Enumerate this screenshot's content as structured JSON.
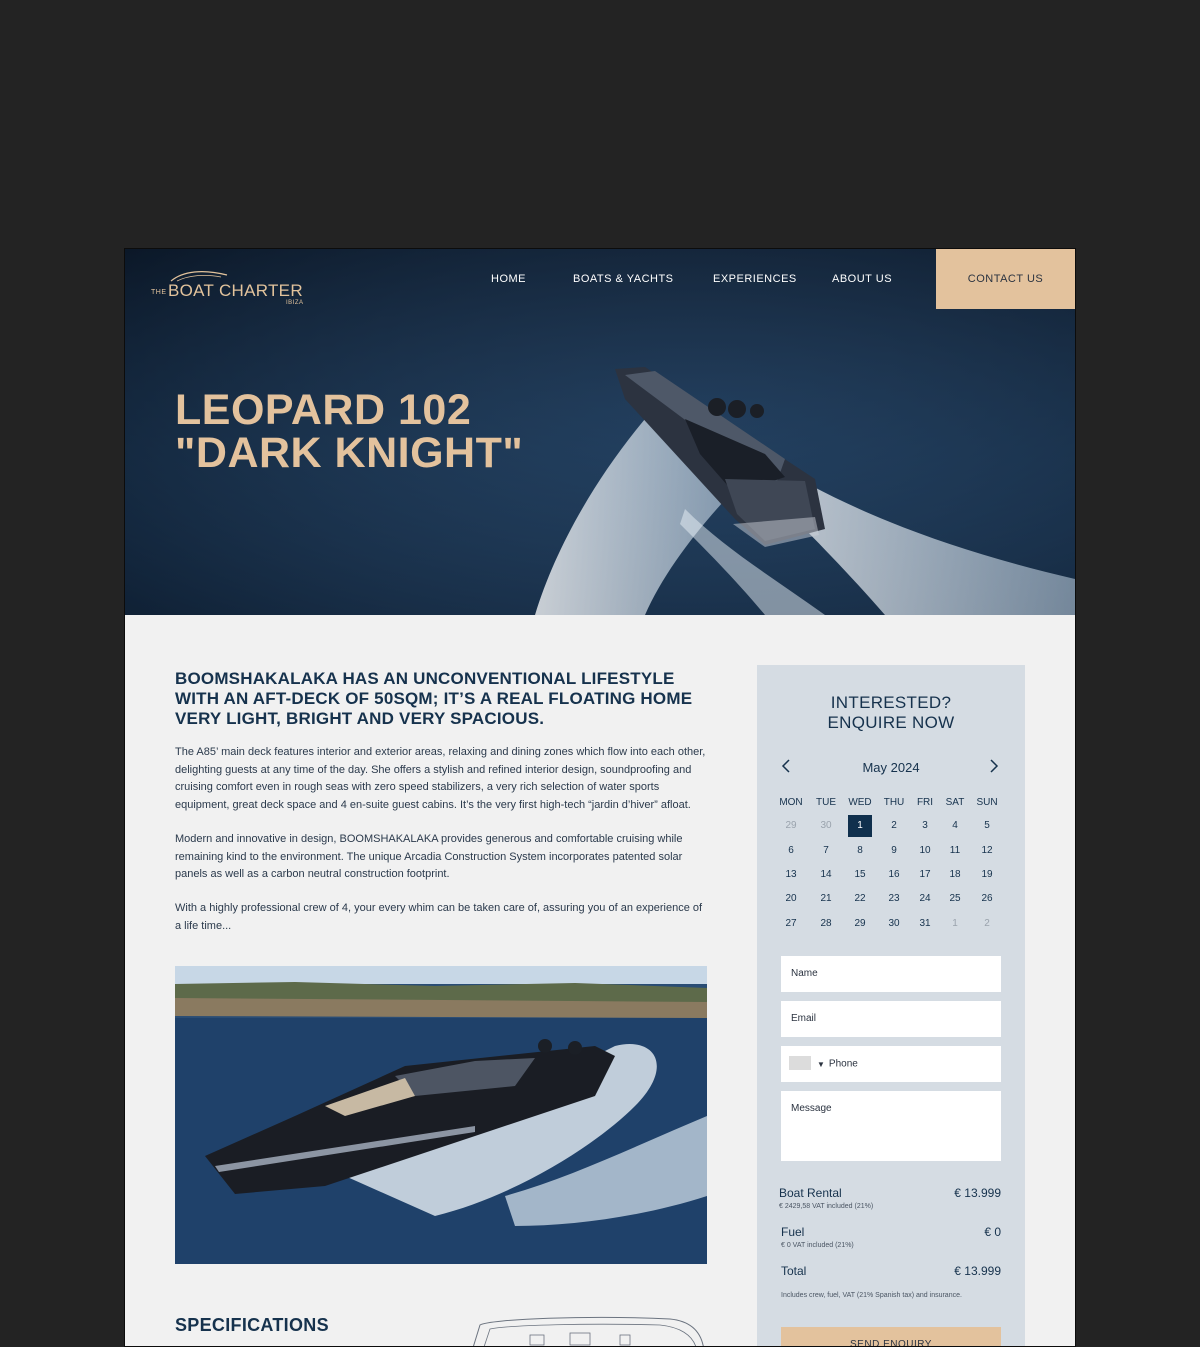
{
  "brand": {
    "logo_prefix": "THE",
    "logo_text": "BOAT CHARTER",
    "logo_suffix": "IBIZA"
  },
  "nav": {
    "items": [
      "HOME",
      "BOATS & YACHTS",
      "EXPERIENCES",
      "ABOUT US"
    ],
    "contact": "CONTACT US"
  },
  "hero": {
    "title": "LEOPARD 102 \"DARK KNIGHT\""
  },
  "content": {
    "lead": "BOOMSHAKALAKA HAS AN UNCONVENTIONAL LIFESTYLE WITH AN AFT-DECK OF 50SQM; IT’S A REAL FLOATING HOME VERY LIGHT, BRIGHT AND VERY SPACIOUS.",
    "paragraphs": [
      "The A85’ main deck features interior and exterior areas, relaxing and dining zones which flow into each other, delighting guests at any time of the day. She offers a stylish and refined interior design, soundproofing and cruising comfort even in rough seas with zero speed stabilizers, a very rich selection of water sports equipment, great deck space and 4 en-suite guest cabins. It’s the very first high-tech “jardin d’hiver” afloat.",
      "Modern and innovative in design, BOOMSHAKALAKA provides generous and comfortable cruising while remaining kind to the environment. The unique Arcadia Construction System incorporates patented solar panels as well as a carbon neutral construction footprint.",
      "With a highly professional crew of 4, your every whim can be taken care of, assuring you of an experience of a life time..."
    ],
    "specifications_title": "SPECIFICATIONS"
  },
  "enquiry": {
    "title_line1": "INTERESTED?",
    "title_line2": "ENQUIRE NOW",
    "calendar": {
      "month": "May 2024",
      "weekdays": [
        "MON",
        "TUE",
        "WED",
        "THU",
        "FRI",
        "SAT",
        "SUN"
      ],
      "days": [
        [
          "29",
          "30",
          "1",
          "2",
          "3",
          "4",
          "5"
        ],
        [
          "6",
          "7",
          "8",
          "9",
          "10",
          "11",
          "12"
        ],
        [
          "13",
          "14",
          "15",
          "16",
          "17",
          "18",
          "19"
        ],
        [
          "20",
          "21",
          "22",
          "23",
          "24",
          "25",
          "26"
        ],
        [
          "27",
          "28",
          "29",
          "30",
          "31",
          "1",
          "2"
        ]
      ],
      "selected_day": "1"
    },
    "form": {
      "name_placeholder": "Name",
      "email_placeholder": "Email",
      "phone_placeholder": "Phone",
      "message_placeholder": "Message"
    },
    "pricing": {
      "rental_label": "Boat Rental",
      "rental_value": "€ 13.999",
      "rental_vat": "€ 2429,58 VAT included (21%)",
      "fuel_label": "Fuel",
      "fuel_value": "€ 0",
      "fuel_vat": "€ 0 VAT included (21%)",
      "total_label": "Total",
      "total_value": "€ 13.999",
      "note": "Includes crew, fuel, VAT (21% Spanish tax) and insurance."
    },
    "submit_label": "SEND ENQUIRY"
  },
  "colors": {
    "accent": "#e3c29d",
    "navy": "#16324d",
    "panel": "#d5dce3",
    "background": "#f1f1f1",
    "outer": "#232323"
  }
}
